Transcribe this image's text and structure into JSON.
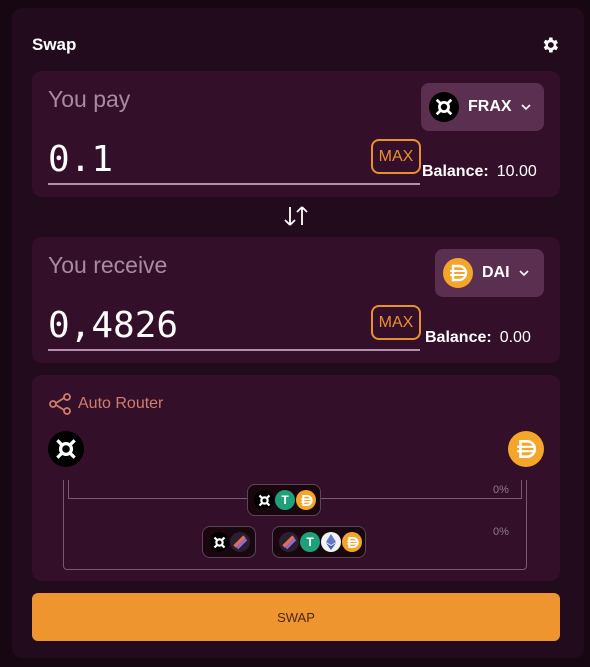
{
  "header": {
    "title": "Swap",
    "settings_icon": "gear-icon"
  },
  "pay": {
    "label": "You pay",
    "amount": "0.1",
    "token": {
      "symbol": "FRAX",
      "icon": "frax-icon"
    },
    "max_label": "MAX",
    "balance_label": "Balance:",
    "balance_value": "10.00"
  },
  "receive": {
    "label": "You receive",
    "amount": "0,4826",
    "token": {
      "symbol": "DAI",
      "icon": "dai-icon"
    },
    "max_label": "MAX",
    "balance_label": "Balance:",
    "balance_value": "0.00"
  },
  "router": {
    "title": "Auto Router",
    "from_icon": "frax-icon",
    "to_icon": "dai-icon",
    "routes": [
      {
        "percent": "0%",
        "hops": [
          [
            "frax-icon",
            "tether-icon",
            "dai-icon"
          ]
        ]
      },
      {
        "percent": "0%",
        "hops": [
          [
            "frax-icon",
            "squid-icon"
          ],
          [
            "squid-icon",
            "tether-icon",
            "eth-icon",
            "dai-icon"
          ]
        ]
      }
    ]
  },
  "actions": {
    "swap_label": "SWAP"
  },
  "colors": {
    "accent": "#ee952f",
    "panel": "#220b1c",
    "card": "#340f2a",
    "token_btn": "#5b2f50",
    "dai": "#f3a62a",
    "tether": "#1ea07a"
  }
}
